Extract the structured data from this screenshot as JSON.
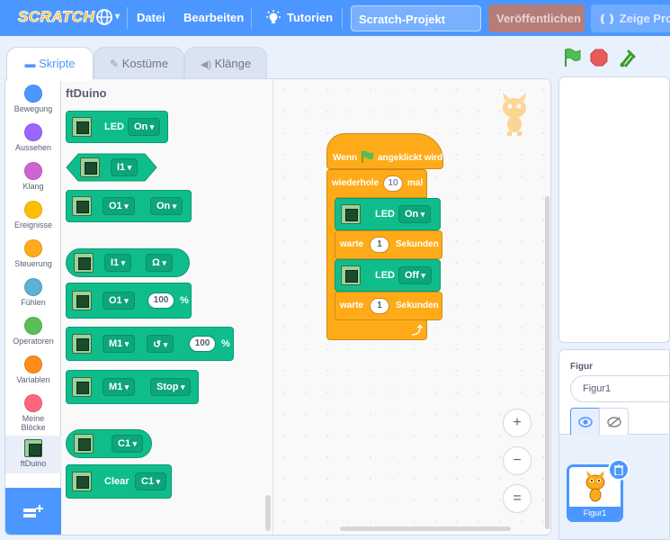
{
  "menu": {
    "logo": "SCRATCH",
    "file": "Datei",
    "edit": "Bearbeiten",
    "tutorials": "Tutorien",
    "project_title": "Scratch-Projekt",
    "publish": "Veröffentlichen",
    "show_page": "Zeige Pro"
  },
  "tabs": {
    "code": "Skripte",
    "costumes": "Kostüme",
    "sounds": "Klänge"
  },
  "categories": [
    {
      "label": "Bewegung",
      "color": "#4c97ff"
    },
    {
      "label": "Aussehen",
      "color": "#9966ff"
    },
    {
      "label": "Klang",
      "color": "#cf63cf"
    },
    {
      "label": "Ereignisse",
      "color": "#ffbf00"
    },
    {
      "label": "Steuerung",
      "color": "#ffab19"
    },
    {
      "label": "Fühlen",
      "color": "#5cb1d6"
    },
    {
      "label": "Operatoren",
      "color": "#59c059"
    },
    {
      "label": "Variablen",
      "color": "#ff8c1a"
    },
    {
      "label": "Meine Blöcke",
      "color": "#ff6680"
    },
    {
      "label": "ftDuino",
      "color": "#0fbd8c"
    }
  ],
  "palette": {
    "title": "ftDuino",
    "led_label": "LED",
    "led_value": "On",
    "input_i1": "I1",
    "output_o1": "O1",
    "output_on": "On",
    "input_i1_b": "I1",
    "input_mode": "Ω",
    "output_o1_b": "O1",
    "pwm_value": "100",
    "percent": "%",
    "motor_m1": "M1",
    "motor_dir": "↺",
    "motor_value": "100",
    "motor_percent": "%",
    "motor_m1_b": "M1",
    "motor_stop": "Stop",
    "counter_c1": "C1",
    "clear_label": "Clear",
    "clear_c1": "C1"
  },
  "script": {
    "when_flag_pre": "Wenn",
    "when_flag_post": "angeklickt wird",
    "repeat_label": "wiederhole",
    "repeat_count": "10",
    "repeat_unit": "mal",
    "led1_label": "LED",
    "led1_value": "On",
    "wait1_label": "warte",
    "wait1_value": "1",
    "wait1_unit": "Sekunden",
    "led2_label": "LED",
    "led2_value": "Off",
    "wait2_label": "warte",
    "wait2_value": "1",
    "wait2_unit": "Sekunden",
    "loop_arrow": "⤴"
  },
  "zoom": {
    "zoom_in": "+",
    "zoom_out": "−",
    "reset": "="
  },
  "sprite_info": {
    "label": "Figur",
    "name": "Figur1"
  },
  "sprites": [
    {
      "name": "Figur1"
    }
  ]
}
